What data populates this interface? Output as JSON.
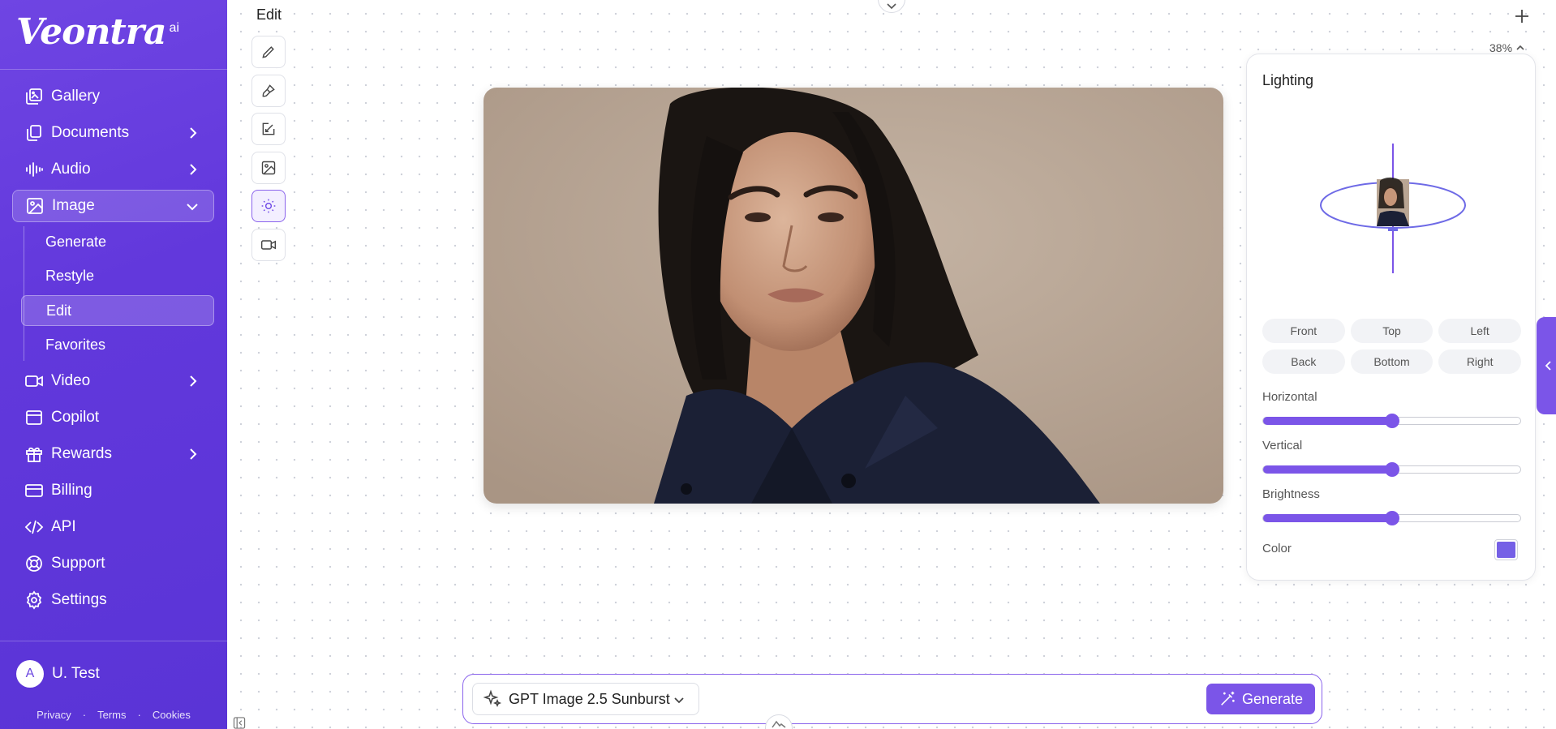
{
  "brand": {
    "name": "Veontra",
    "suffix": "ai"
  },
  "sidebar": {
    "items": [
      {
        "label": "Gallery",
        "icon": "gallery-icon"
      },
      {
        "label": "Documents",
        "icon": "documents-icon",
        "chevron": "right"
      },
      {
        "label": "Audio",
        "icon": "audio-icon",
        "chevron": "right"
      },
      {
        "label": "Image",
        "icon": "image-icon",
        "chevron": "down",
        "active": true
      },
      {
        "label": "Video",
        "icon": "video-icon",
        "chevron": "right"
      },
      {
        "label": "Copilot",
        "icon": "copilot-icon"
      },
      {
        "label": "Rewards",
        "icon": "rewards-icon",
        "chevron": "right"
      },
      {
        "label": "Billing",
        "icon": "billing-icon"
      },
      {
        "label": "API",
        "icon": "api-icon"
      },
      {
        "label": "Support",
        "icon": "support-icon"
      },
      {
        "label": "Settings",
        "icon": "settings-icon"
      }
    ],
    "image_sub": [
      "Generate",
      "Restyle",
      "Edit",
      "Favorites"
    ],
    "image_sub_active": "Edit",
    "user": {
      "initial": "A",
      "name": "U. Test"
    },
    "footer": [
      "Privacy",
      "Terms",
      "Cookies"
    ]
  },
  "canvas": {
    "title": "Edit",
    "zoom": "38%",
    "tools": [
      "pencil-icon",
      "brush-icon",
      "resize-icon",
      "image-icon",
      "sun-icon",
      "video-camera-icon"
    ],
    "active_tool": "sun-icon"
  },
  "lighting": {
    "title": "Lighting",
    "directions": [
      "Front",
      "Top",
      "Left",
      "Back",
      "Bottom",
      "Right"
    ],
    "sliders": [
      {
        "label": "Horizontal",
        "value": 0.5
      },
      {
        "label": "Vertical",
        "value": 0.5
      },
      {
        "label": "Brightness",
        "value": 0.5
      }
    ],
    "color_label": "Color",
    "color": "#7560e6"
  },
  "prompt": {
    "model": "GPT Image 2.5 Sunburst",
    "generate_label": "Generate"
  },
  "colors": {
    "accent": "#7b55e8",
    "sidebar": "#6238dc"
  }
}
